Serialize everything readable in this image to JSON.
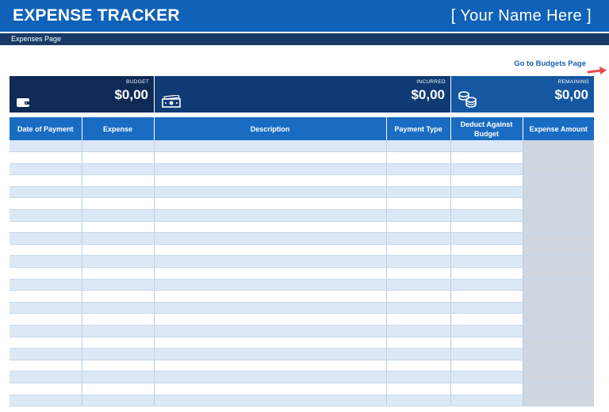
{
  "header": {
    "app_title": "EXPENSE TRACKER",
    "user_name": "[ Your Name Here ]"
  },
  "subheader": {
    "page_label": "Expenses Page"
  },
  "nav": {
    "budgets_link": "Go to Budgets Page",
    "arrow_icon": "right-arrow-icon",
    "arrow_color": "#e74c4c"
  },
  "summary": {
    "budget": {
      "label": "BUDGET",
      "value": "$0,00",
      "icon": "wallet-icon"
    },
    "incurred": {
      "label": "INCURRED",
      "value": "$0,00",
      "icon": "cash-icon"
    },
    "remaining": {
      "label": "REMAINING",
      "value": "$0,00",
      "icon": "coins-icon"
    }
  },
  "table": {
    "columns": [
      "Date of Payment",
      "Expense",
      "Description",
      "Payment Type",
      "Deduct Against Budget",
      "Expense Amount"
    ],
    "row_count": 23
  },
  "colors": {
    "title_bar": "#0f62b8",
    "sub_bar": "#173a66",
    "header_row": "#1a6cc2",
    "band_row": "#dce8f6",
    "amount_col": "#cfd6df"
  }
}
